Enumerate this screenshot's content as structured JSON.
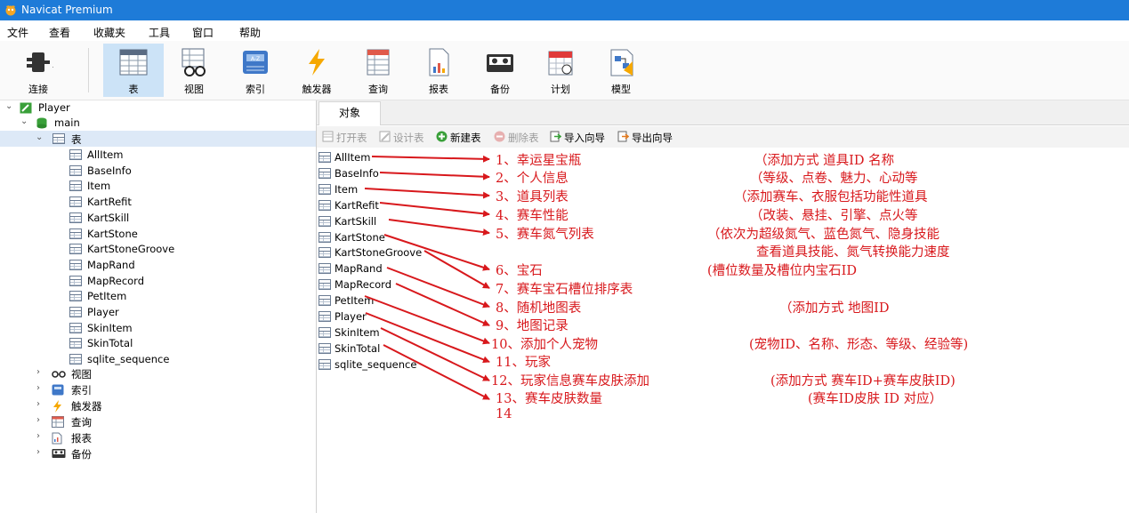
{
  "app": {
    "title": "Navicat Premium"
  },
  "menu": [
    "文件",
    "查看",
    "收藏夹",
    "工具",
    "窗口",
    "帮助"
  ],
  "toolbar": [
    {
      "label": "连接",
      "icon": "plug-icon"
    },
    {
      "label": "表",
      "icon": "table-icon",
      "active": true
    },
    {
      "label": "视图",
      "icon": "glasses-icon"
    },
    {
      "label": "索引",
      "icon": "index-icon"
    },
    {
      "label": "触发器",
      "icon": "lightning-icon"
    },
    {
      "label": "查询",
      "icon": "query-icon"
    },
    {
      "label": "报表",
      "icon": "report-icon"
    },
    {
      "label": "备份",
      "icon": "backup-icon"
    },
    {
      "label": "计划",
      "icon": "calendar-icon"
    },
    {
      "label": "模型",
      "icon": "model-icon"
    }
  ],
  "tree": {
    "connection": "Player",
    "database": "main",
    "tables_node": "表",
    "tables": [
      "AllItem",
      "BaseInfo",
      "Item",
      "KartRefit",
      "KartSkill",
      "KartStone",
      "KartStoneGroove",
      "MapRand",
      "MapRecord",
      "PetItem",
      "Player",
      "SkinItem",
      "SkinTotal",
      "sqlite_sequence"
    ],
    "other_nodes": [
      {
        "label": "视图",
        "icon": "glasses-icon"
      },
      {
        "label": "索引",
        "icon": "index-icon"
      },
      {
        "label": "触发器",
        "icon": "lightning-icon"
      },
      {
        "label": "查询",
        "icon": "query-icon"
      },
      {
        "label": "报表",
        "icon": "report-icon"
      },
      {
        "label": "备份",
        "icon": "backup-icon"
      }
    ]
  },
  "tab": {
    "label": "对象"
  },
  "object_toolbar": [
    {
      "label": "打开表",
      "icon": "open-table-icon",
      "enabled": false
    },
    {
      "label": "设计表",
      "icon": "design-table-icon",
      "enabled": false
    },
    {
      "label": "新建表",
      "icon": "new-table-icon",
      "enabled": true
    },
    {
      "label": "删除表",
      "icon": "delete-table-icon",
      "enabled": false
    },
    {
      "label": "导入向导",
      "icon": "import-icon",
      "enabled": true
    },
    {
      "label": "导出向导",
      "icon": "export-icon",
      "enabled": true
    }
  ],
  "objects": [
    "AllItem",
    "BaseInfo",
    "Item",
    "KartRefit",
    "KartSkill",
    "KartStone",
    "KartStoneGroove",
    "MapRand",
    "MapRecord",
    "PetItem",
    "Player",
    "SkinItem",
    "SkinTotal",
    "sqlite_sequence"
  ],
  "annotations": [
    {
      "text": "1、幸运星宝瓶",
      "note": "（添加方式    道具ID 名称"
    },
    {
      "text": "2、个人信息",
      "note": "（等级、点卷、魅力、心动等"
    },
    {
      "text": "3、道具列表",
      "note": "（添加赛车、衣服包括功能性道具"
    },
    {
      "text": "4、赛车性能",
      "note": "（改装、悬挂、引擎、点火等"
    },
    {
      "text": "5、赛车氮气列表",
      "note": "（依次为超级氮气、蓝色氮气、隐身技能"
    },
    {
      "text": "",
      "note": "查看道具技能、氮气转换能力速度"
    },
    {
      "text": "6、宝石",
      "note": "(槽位数量及槽位内宝石ID"
    },
    {
      "text": "7、赛车宝石槽位排序表",
      "note": ""
    },
    {
      "text": "8、随机地图表",
      "note": "（添加方式     地图ID"
    },
    {
      "text": "9、地图记录",
      "note": ""
    },
    {
      "text": "10、添加个人宠物",
      "note": "(宠物ID、名称、形态、等级、经验等)"
    },
    {
      "text": "11、玩家",
      "note": ""
    },
    {
      "text": "12、玩家信息赛车皮肤添加",
      "note": "(添加方式 赛车ID+赛车皮肤ID)"
    },
    {
      "text": "13、赛车皮肤数量",
      "note": "(赛车ID皮肤 ID 对应）"
    },
    {
      "text": "14",
      "note": ""
    }
  ],
  "colors": {
    "titlebar": "#1e7bd8",
    "annotation": "#d8181c",
    "selection": "#dde9f7"
  }
}
